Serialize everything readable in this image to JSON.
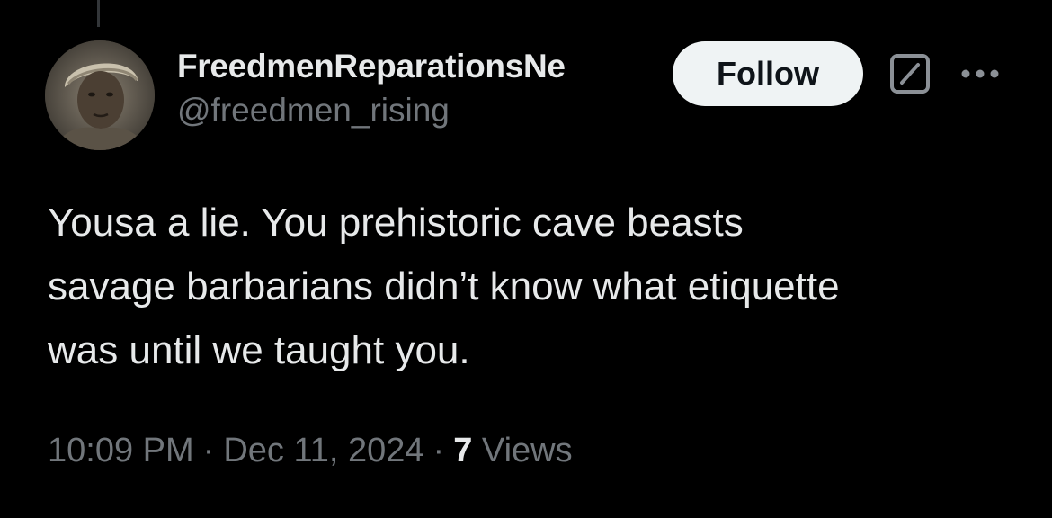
{
  "tweet": {
    "author": {
      "display_name": "FreedmenReparationsNe",
      "handle": "@freedmen_rising"
    },
    "follow_label": "Follow",
    "text_lines": [
      "Yousa a lie. You prehistoric cave beasts",
      "savage barbarians didn’t know what etiquette",
      "was until we taught you."
    ],
    "time": "10:09 PM",
    "separator": "·",
    "date": "Dec 11, 2024",
    "views_count": "7",
    "views_label": "Views"
  },
  "icons": {
    "grok": "grok-icon",
    "more": "more-options-icon"
  },
  "colors": {
    "background": "#000000",
    "text_primary": "#e7e9ea",
    "text_secondary": "#71767b",
    "follow_bg": "#eff3f4",
    "follow_text": "#0f1419"
  }
}
